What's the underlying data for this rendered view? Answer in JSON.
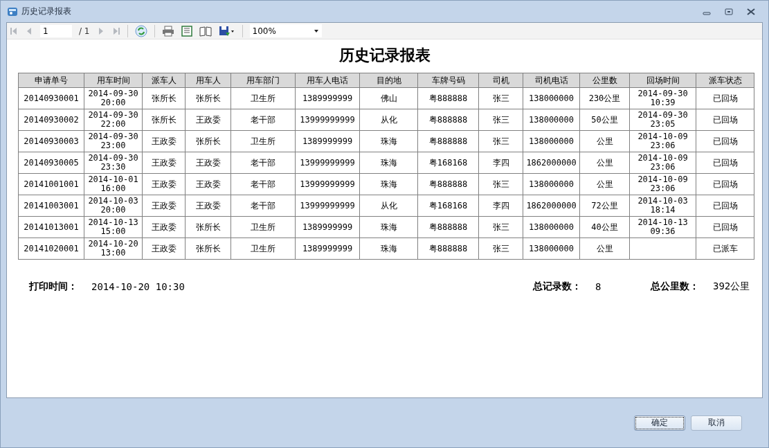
{
  "window": {
    "title": "历史记录报表"
  },
  "toolbar": {
    "page": "1",
    "page_total": "/ 1",
    "zoom": "100%"
  },
  "report": {
    "title": "历史记录报表",
    "columns": [
      "申请单号",
      "用车时间",
      "派车人",
      "用车人",
      "用车部门",
      "用车人电话",
      "目的地",
      "车牌号码",
      "司机",
      "司机电话",
      "公里数",
      "回场时间",
      "派车状态"
    ],
    "rows": [
      [
        "20140930001",
        "2014-09-30 20:00",
        "张所长",
        "张所长",
        "卫生所",
        "1389999999",
        "佛山",
        "粤888888",
        "张三",
        "138000000",
        "230公里",
        "2014-09-30 10:39",
        "已回场"
      ],
      [
        "20140930002",
        "2014-09-30 22:00",
        "张所长",
        "王政委",
        "老干部",
        "13999999999",
        "从化",
        "粤888888",
        "张三",
        "138000000",
        "50公里",
        "2014-09-30 23:05",
        "已回场"
      ],
      [
        "20140930003",
        "2014-09-30 23:00",
        "王政委",
        "张所长",
        "卫生所",
        "1389999999",
        "珠海",
        "粤888888",
        "张三",
        "138000000",
        "公里",
        "2014-10-09 23:06",
        "已回场"
      ],
      [
        "20140930005",
        "2014-09-30 23:30",
        "王政委",
        "王政委",
        "老干部",
        "13999999999",
        "珠海",
        "粤168168",
        "李四",
        "1862000000",
        "公里",
        "2014-10-09 23:06",
        "已回场"
      ],
      [
        "20141001001",
        "2014-10-01 16:00",
        "王政委",
        "王政委",
        "老干部",
        "13999999999",
        "珠海",
        "粤888888",
        "张三",
        "138000000",
        "公里",
        "2014-10-09 23:06",
        "已回场"
      ],
      [
        "20141003001",
        "2014-10-03 20:00",
        "王政委",
        "王政委",
        "老干部",
        "13999999999",
        "从化",
        "粤168168",
        "李四",
        "1862000000",
        "72公里",
        "2014-10-03 18:14",
        "已回场"
      ],
      [
        "20141013001",
        "2014-10-13 15:00",
        "王政委",
        "张所长",
        "卫生所",
        "1389999999",
        "珠海",
        "粤888888",
        "张三",
        "138000000",
        "40公里",
        "2014-10-13 09:36",
        "已回场"
      ],
      [
        "20141020001",
        "2014-10-20 13:00",
        "王政委",
        "张所长",
        "卫生所",
        "1389999999",
        "珠海",
        "粤888888",
        "张三",
        "138000000",
        "公里",
        "",
        "已派车"
      ]
    ],
    "summary": {
      "print_time_label": "打印时间：",
      "print_time": "2014-10-20 10:30",
      "count_label": "总记录数：",
      "count": "8",
      "km_label": "总公里数：",
      "km": "392公里"
    }
  },
  "buttons": [
    {
      "label": "确定",
      "focused": true
    },
    {
      "label": "取消",
      "focused": false
    }
  ]
}
